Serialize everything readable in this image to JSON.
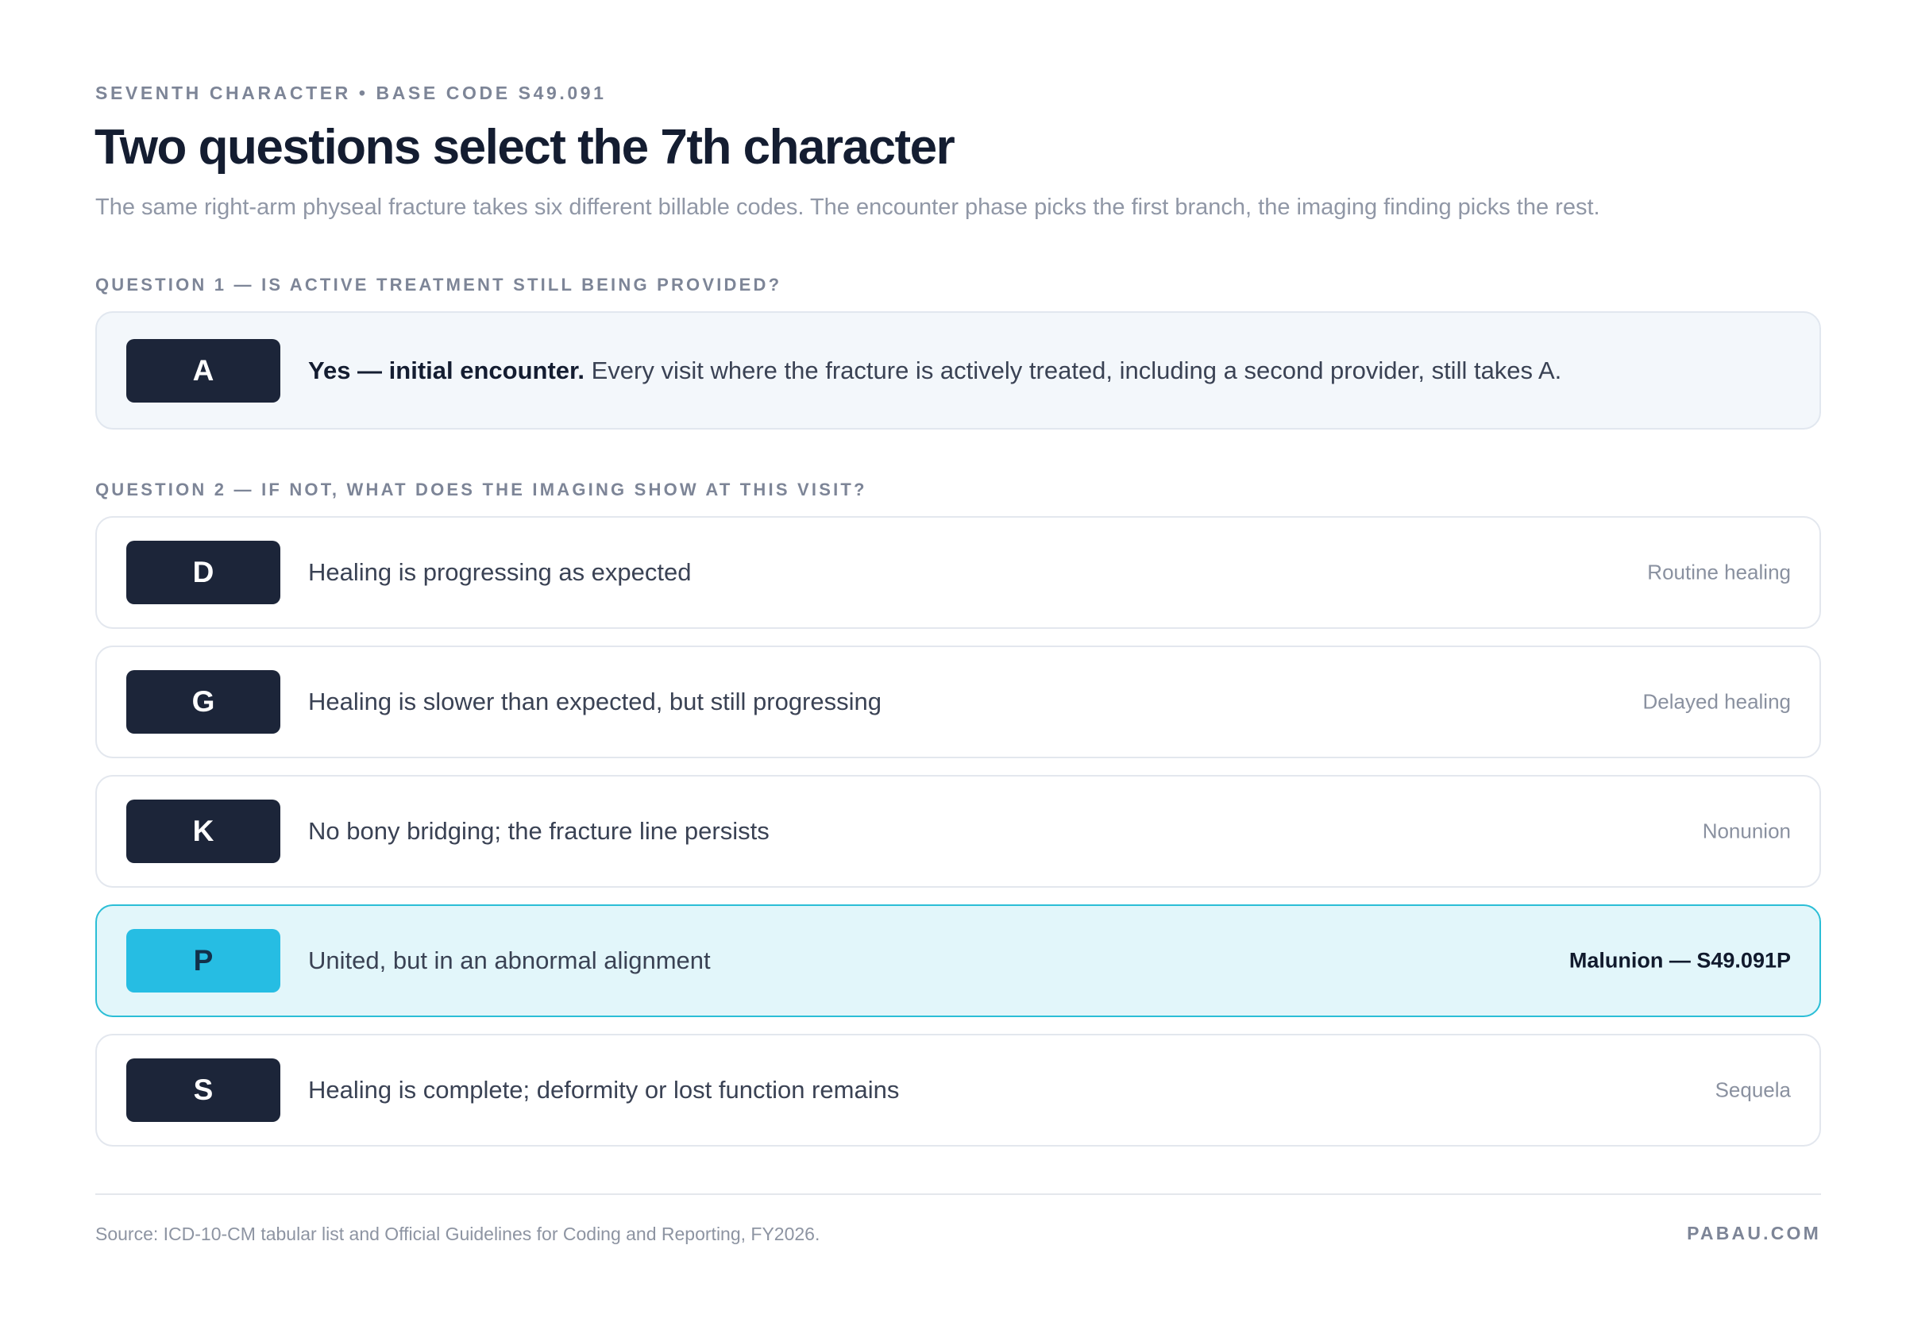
{
  "header": {
    "eyebrow": "SEVENTH CHARACTER • BASE CODE S49.091",
    "title": "Two questions select the 7th character",
    "subtitle": "The same right-arm physeal fracture takes six different billable codes. The encounter phase picks the first branch, the imaging finding picks the rest."
  },
  "question1": {
    "label": "QUESTION 1 — IS ACTIVE TREATMENT STILL BEING PROVIDED?",
    "option": {
      "code": "A",
      "lead": "Yes — initial encounter.",
      "text": " Every visit where the fracture is actively treated, including a second provider, still takes A."
    }
  },
  "question2": {
    "label": "QUESTION 2 — IF NOT, WHAT DOES THE IMAGING SHOW AT THIS VISIT?",
    "options": [
      {
        "code": "D",
        "text": "Healing is progressing as expected",
        "outcome": "Routine healing"
      },
      {
        "code": "G",
        "text": "Healing is slower than expected, but still progressing",
        "outcome": "Delayed healing"
      },
      {
        "code": "K",
        "text": "No bony bridging; the fracture line persists",
        "outcome": "Nonunion"
      },
      {
        "code": "P",
        "text": "United, but in an abnormal alignment",
        "outcome": "Malunion — S49.091P",
        "highlighted": true
      },
      {
        "code": "S",
        "text": "Healing is complete; deformity or lost function remains",
        "outcome": "Sequela"
      }
    ]
  },
  "footer": {
    "source": "Source: ICD-10-CM tabular list and Official Guidelines for Coding and Reporting, FY2026.",
    "brand": "PABAU.COM"
  },
  "colors": {
    "badge_dark": "#1c2539",
    "highlight_fill": "#e2f6fa",
    "highlight_border": "#2bbed6",
    "highlight_badge": "#26bde3"
  }
}
